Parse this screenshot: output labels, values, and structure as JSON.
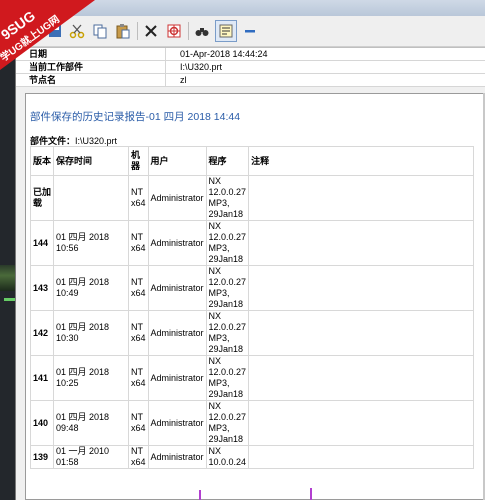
{
  "properties": [
    {
      "key": "日期",
      "value": "01-Apr-2018 14:44:24"
    },
    {
      "key": "当前工作部件",
      "value": "I:\\U320.prt"
    },
    {
      "key": "节点名",
      "value": "zl"
    }
  ],
  "report": {
    "title": "部件保存的历史记录报告-01 四月 2018 14:44",
    "file_label": "部件文件：",
    "file_value": "I:\\U320.prt",
    "headers": [
      "版本",
      "保存时间",
      "机器",
      "用户",
      "程序",
      "注释"
    ],
    "rows": [
      {
        "ver": "已加载",
        "time": "",
        "machine": "NT x64",
        "user": "Administrator",
        "program": "NX 12.0.0.27 MP3, 29Jan18",
        "note": ""
      },
      {
        "ver": "144",
        "time": "01 四月 2018 10:56",
        "machine": "NT x64",
        "user": "Administrator",
        "program": "NX 12.0.0.27 MP3, 29Jan18",
        "note": ""
      },
      {
        "ver": "143",
        "time": "01 四月 2018 10:49",
        "machine": "NT x64",
        "user": "Administrator",
        "program": "NX 12.0.0.27 MP3, 29Jan18",
        "note": ""
      },
      {
        "ver": "142",
        "time": "01 四月 2018 10:30",
        "machine": "NT x64",
        "user": "Administrator",
        "program": "NX 12.0.0.27 MP3, 29Jan18",
        "note": ""
      },
      {
        "ver": "141",
        "time": "01 四月 2018 10:25",
        "machine": "NT x64",
        "user": "Administrator",
        "program": "NX 12.0.0.27 MP3, 29Jan18",
        "note": ""
      },
      {
        "ver": "140",
        "time": "01 四月 2018 09:48",
        "machine": "NT x64",
        "user": "Administrator",
        "program": "NX 12.0.0.27 MP3, 29Jan18",
        "note": ""
      },
      {
        "ver": "139",
        "time": "01 一月 2010 01:58",
        "machine": "NT x64",
        "user": "Administrator",
        "program": "NX 10.0.0.24",
        "note": ""
      }
    ]
  },
  "watermark": {
    "line1": "9SUG",
    "line2": "学UG就上UG网"
  },
  "colors": {
    "title_blue": "#2a5ca8",
    "watermark_red": "#d0191e"
  }
}
